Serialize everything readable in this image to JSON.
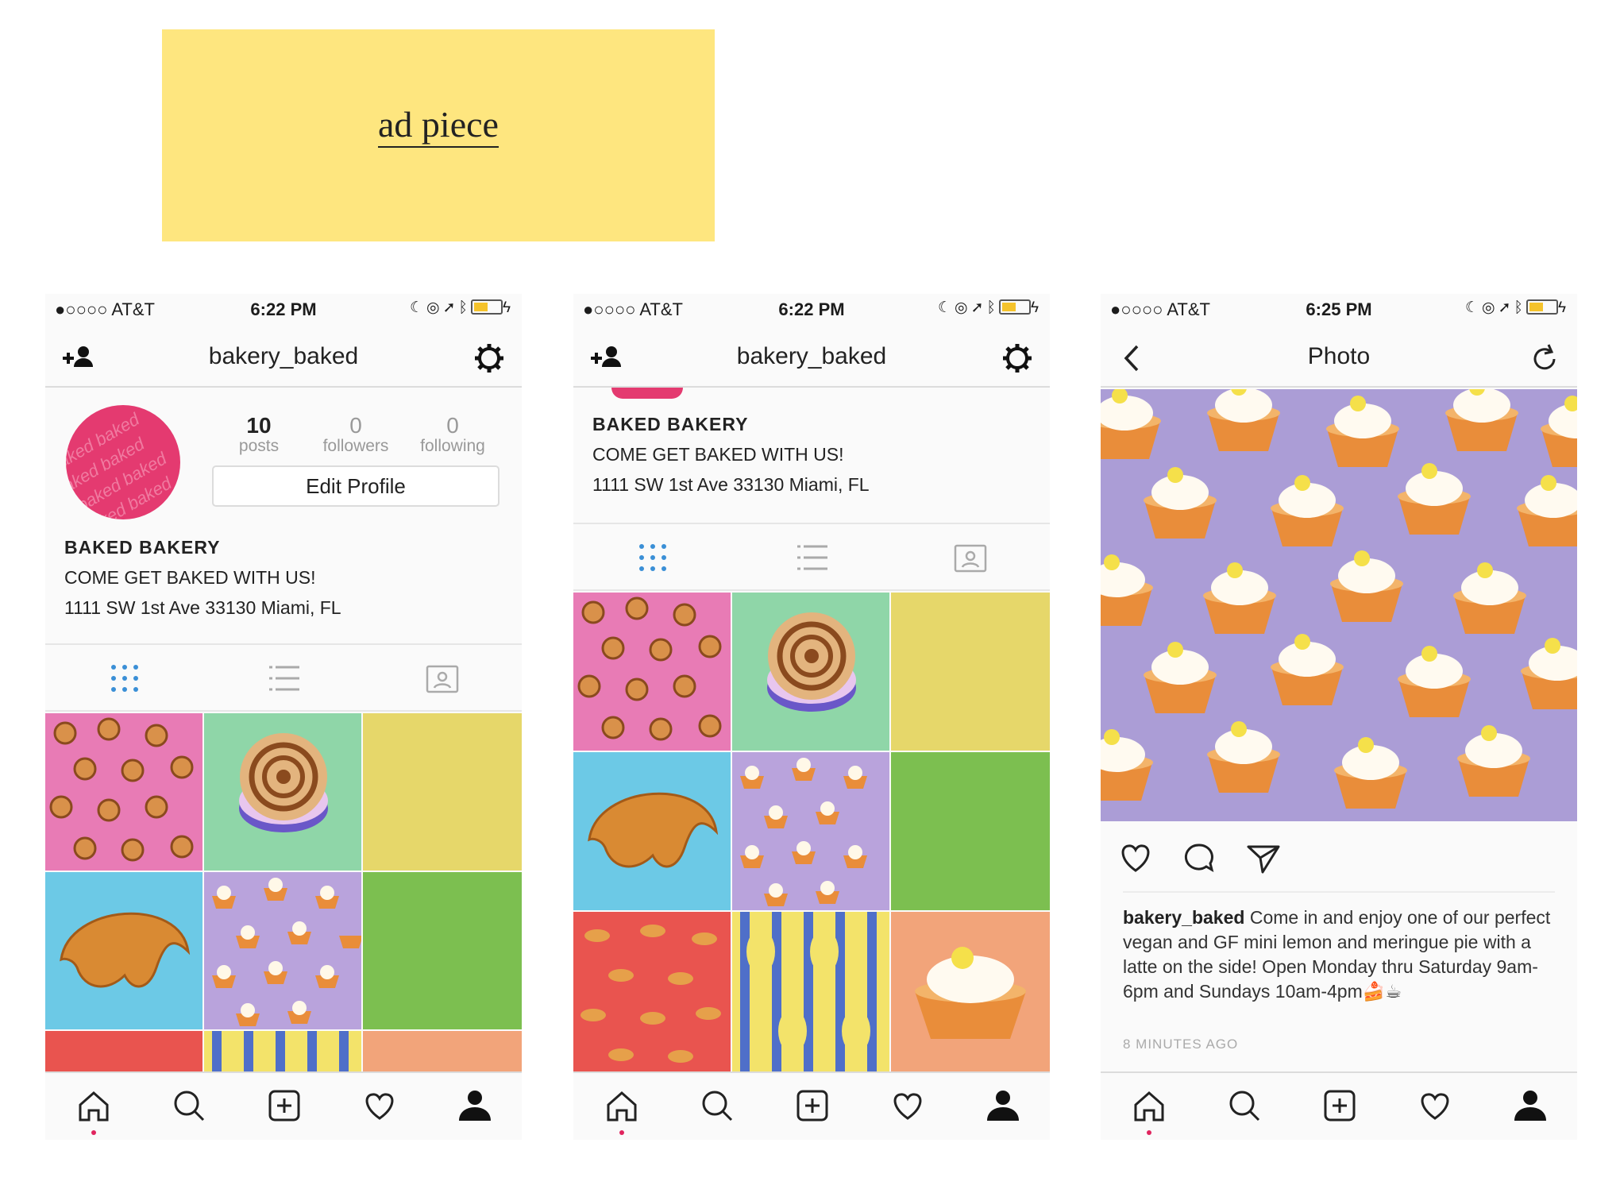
{
  "ad": {
    "title": "ad piece"
  },
  "status_bars": {
    "carrier": "●○○○○ AT&T",
    "time_1": "6:22 PM",
    "time_2": "6:22 PM",
    "time_3": "6:25 PM"
  },
  "profile": {
    "username": "bakery_baked",
    "posts_count": "10",
    "posts_label": "posts",
    "followers_count": "0",
    "followers_label": "followers",
    "following_count": "0",
    "following_label": "following",
    "edit_button": "Edit Profile",
    "bio_name": "BAKED BAKERY",
    "bio_line1": "COME GET BAKED WITH US!",
    "bio_line2": "1111 SW 1st Ave 33130 Miami, FL",
    "avatar_text": "baked"
  },
  "photo_screen": {
    "title": "Photo",
    "caption_user": "bakery_baked",
    "caption_text": " Come in and enjoy one of our perfect vegan and GF mini lemon and meringue pie with a latte on the side! Open Monday thru Saturday 9am-6pm and Sundays 10am-4pm🍰☕",
    "timestamp": "8 MINUTES AGO"
  },
  "icons": {
    "status": [
      "signal-dots",
      "wifi-icon",
      "moon-icon",
      "lock-rotation-icon",
      "location-icon",
      "bluetooth-icon",
      "battery-icon",
      "charging-icon"
    ],
    "nav": [
      "add-user-icon",
      "gear-icon",
      "back-icon",
      "refresh-icon"
    ],
    "tabs": [
      "grid-icon",
      "list-icon",
      "tagged-icon"
    ],
    "bottom": [
      "home-icon",
      "search-icon",
      "add-post-icon",
      "heart-icon",
      "profile-icon"
    ],
    "actions": [
      "like-icon",
      "comment-icon",
      "share-icon"
    ]
  },
  "colors": {
    "ad_background": "#fee67f",
    "tab_active": "#3a8fd6",
    "avatar": "#e43a70",
    "tile_pink": "#e87bb5",
    "tile_mint": "#8fd6a8",
    "tile_yellow": "#e6d76a",
    "tile_sky": "#6cc9e6",
    "tile_lavender": "#b9a3dc",
    "tile_green": "#7cbf50",
    "tile_red": "#e9544f",
    "tile_pattern": "#f3e36a",
    "tile_peach": "#f2a47a",
    "photo_background": "#ab9dd6"
  }
}
